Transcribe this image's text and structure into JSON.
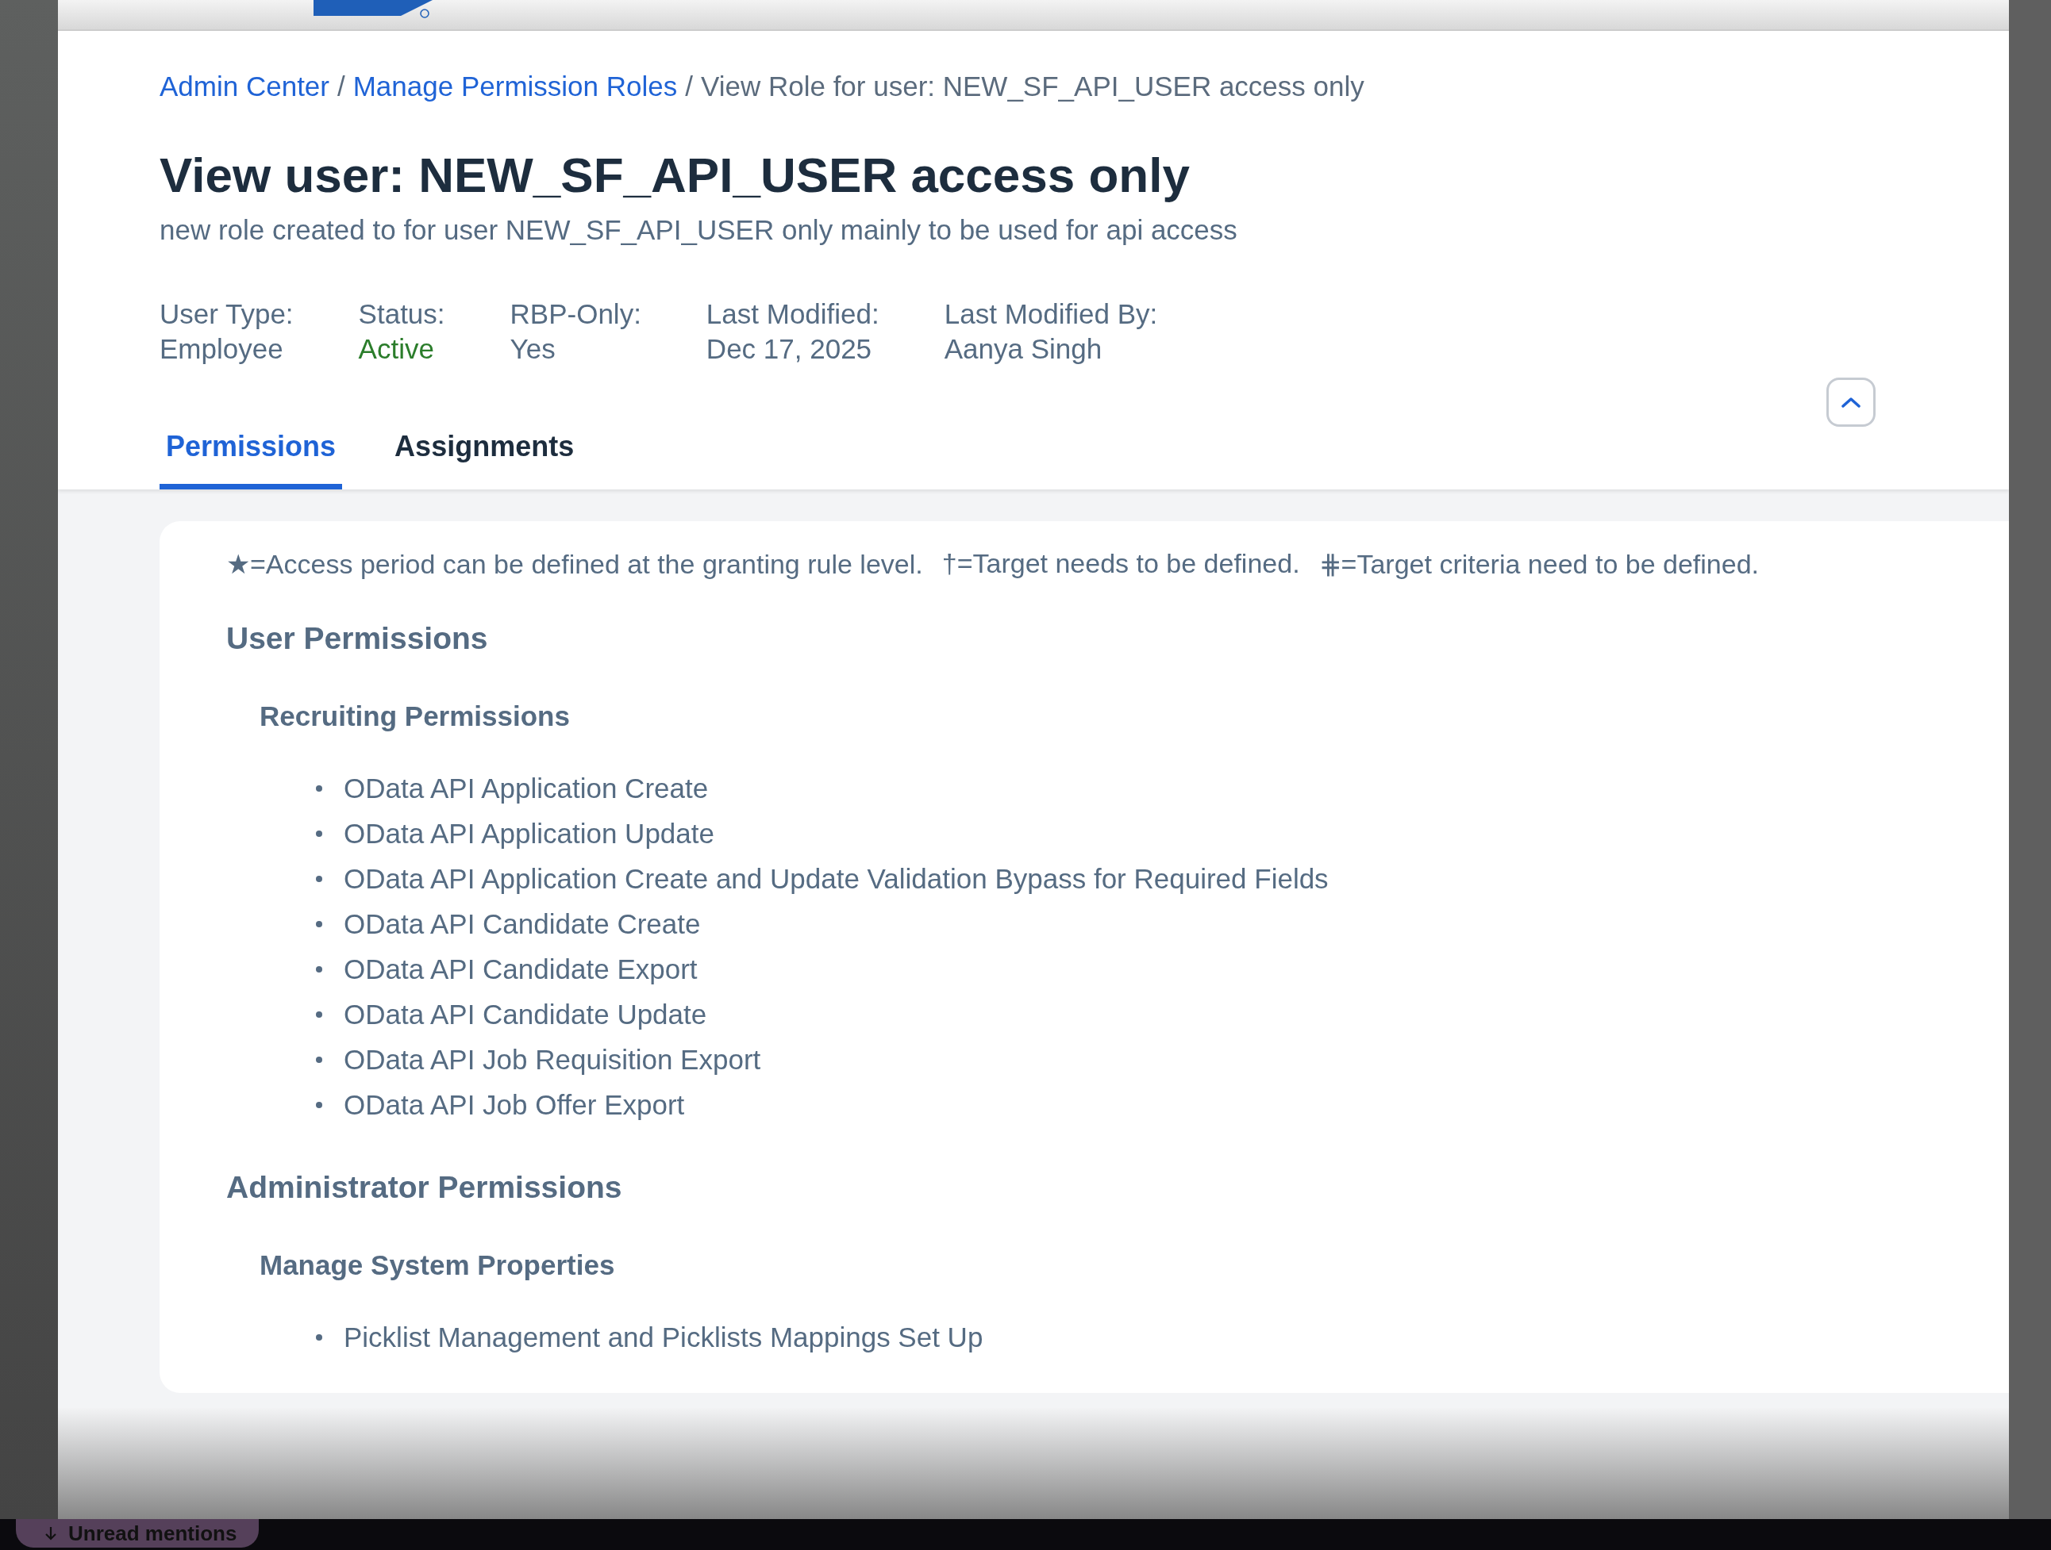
{
  "breadcrumb": {
    "separator": "/",
    "items": [
      {
        "text": "Admin Center",
        "link": true
      },
      {
        "text": "Manage Permission Roles",
        "link": true
      },
      {
        "text": "View Role for user: NEW_SF_API_USER access only",
        "link": false
      }
    ]
  },
  "title": "View user: NEW_SF_API_USER access only",
  "subtitle": "new role created to for user NEW_SF_API_USER only mainly to be used for api access",
  "meta": [
    {
      "label": "User Type:",
      "value": "Employee",
      "kind": "plain"
    },
    {
      "label": "Status:",
      "value": "Active",
      "kind": "status"
    },
    {
      "label": "RBP-Only:",
      "value": "Yes",
      "kind": "plain"
    },
    {
      "label": "Last Modified:",
      "value": "Dec 17, 2025",
      "kind": "plain"
    },
    {
      "label": "Last Modified By:",
      "value": "Aanya Singh",
      "kind": "plain"
    }
  ],
  "tabs": [
    {
      "label": "Permissions",
      "selected": true
    },
    {
      "label": "Assignments",
      "selected": false
    }
  ],
  "legend": [
    {
      "symbol": "★",
      "text": "=Access period can be defined at the granting rule level."
    },
    {
      "symbol": "†",
      "text": "=Target needs to be defined."
    },
    {
      "symbol": "⋕",
      "text": "=Target criteria need to be defined."
    }
  ],
  "sections": [
    {
      "title": "User Permissions",
      "groups": [
        {
          "title": "Recruiting Permissions",
          "items": [
            "OData API Application Create",
            "OData API Application Update",
            "OData API Application Create and Update Validation Bypass for Required Fields",
            "OData API Candidate Create",
            "OData API Candidate Export",
            "OData API Candidate Update",
            "OData API Job Requisition Export",
            "OData API Job Offer Export"
          ]
        }
      ]
    },
    {
      "title": "Administrator Permissions",
      "groups": [
        {
          "title": "Manage System Properties",
          "items": [
            "Picklist Management and Picklists Mappings Set Up"
          ]
        }
      ]
    }
  ],
  "bottom_bar": {
    "label": "Unread mentions"
  }
}
